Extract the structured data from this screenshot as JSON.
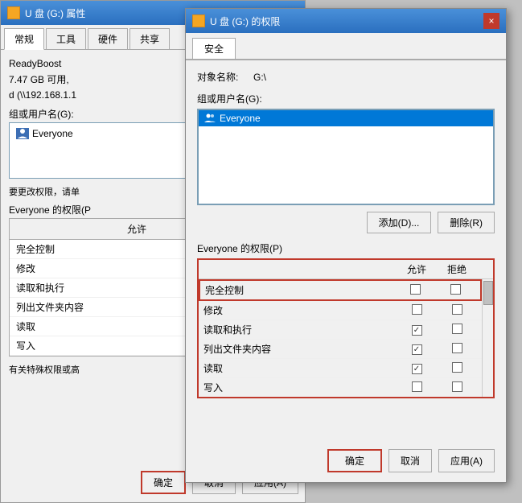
{
  "bg_window": {
    "title": "U 盘 (G:) 属性",
    "tabs": [
      {
        "label": "常规"
      },
      {
        "label": "工具"
      },
      {
        "label": "硬件"
      },
      {
        "label": "共享"
      }
    ],
    "active_tab": "常规",
    "readyboost_label": "ReadyBoost",
    "disk_size": "7.47 GB 可用,",
    "network_label": "d (\\\\192.168.1.1",
    "group_label": "组或用户名(G):",
    "group_users": [
      {
        "name": "Everyone",
        "icon": "user-group"
      }
    ],
    "hint": "要更改权限，请单",
    "perms_label": "Everyone 的权限(P",
    "perms": [
      {
        "name": "完全控制",
        "allow": false,
        "deny": false
      },
      {
        "name": "修改",
        "allow": false,
        "deny": false
      },
      {
        "name": "读取和执行",
        "allow": true,
        "deny": false
      },
      {
        "name": "列出文件夹内容",
        "allow": true,
        "deny": false
      },
      {
        "name": "读取",
        "allow": true,
        "deny": false
      },
      {
        "name": "写入",
        "allow": false,
        "deny": false
      }
    ],
    "special_hint": "有关特殊权限或高",
    "buttons": {
      "ok": "确定",
      "cancel": "取消",
      "apply": "应用(A)"
    }
  },
  "dialog": {
    "title": "U 盘 (G:) 的权限",
    "close_btn": "×",
    "tabs": [
      {
        "label": "安全"
      }
    ],
    "active_tab": "安全",
    "object_label": "对象名称:",
    "object_value": "G:\\",
    "group_label": "组或用户名(G):",
    "group_users": [
      {
        "name": "Everyone",
        "icon": "user-group",
        "selected": true
      }
    ],
    "add_btn": "添加(D)...",
    "delete_btn": "删除(R)",
    "perms_label": "Everyone 的权限(P)",
    "perms_col_allow": "允许",
    "perms_col_deny": "拒绝",
    "perms": [
      {
        "name": "完全控制",
        "allow": false,
        "deny": false,
        "highlighted": true
      },
      {
        "name": "修改",
        "allow": false,
        "deny": false
      },
      {
        "name": "读取和执行",
        "allow": true,
        "deny": false
      },
      {
        "name": "列出文件夹内容",
        "allow": true,
        "deny": false
      },
      {
        "name": "读取",
        "allow": true,
        "deny": false
      },
      {
        "name": "写入",
        "allow": false,
        "deny": false
      }
    ],
    "buttons": {
      "ok": "确定",
      "cancel": "取消",
      "apply": "应用(A)"
    }
  }
}
